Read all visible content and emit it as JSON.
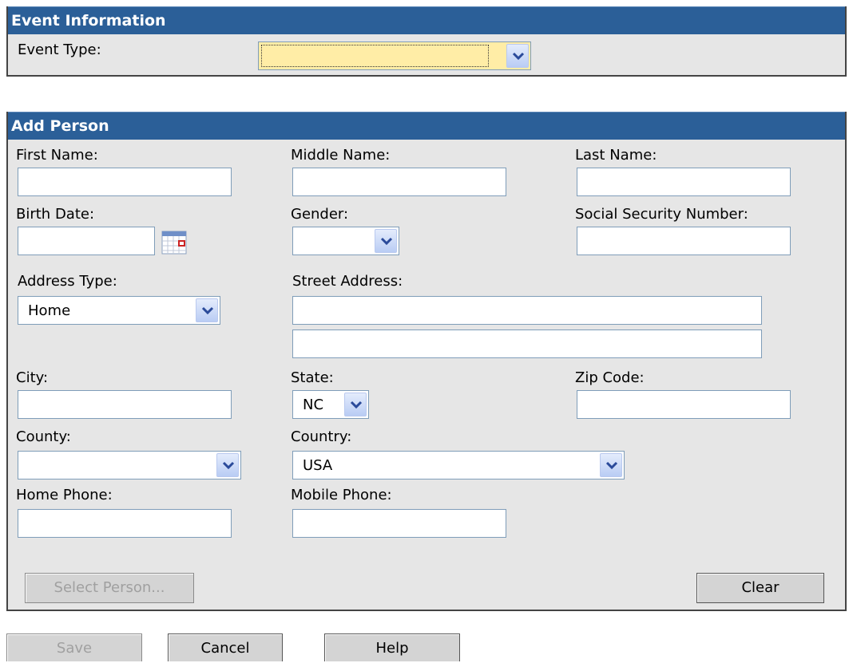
{
  "event": {
    "header": "Event Information",
    "event_type_label": "Event Type:",
    "event_type_value": ""
  },
  "person": {
    "header": "Add Person",
    "first_name_label": "First Name:",
    "middle_name_label": "Middle Name:",
    "last_name_label": "Last Name:",
    "birth_date_label": "Birth Date:",
    "gender_label": "Gender:",
    "gender_value": "",
    "ssn_label": "Social Security Number:",
    "address_type_label": "Address Type:",
    "address_type_value": "Home",
    "street_address_label": "Street Address:",
    "city_label": "City:",
    "state_label": "State:",
    "state_value": "NC",
    "zip_label": "Zip Code:",
    "county_label": "County:",
    "county_value": "",
    "country_label": "Country:",
    "country_value": "USA",
    "home_phone_label": "Home Phone:",
    "mobile_phone_label": "Mobile Phone:",
    "select_person_label": "Select Person...",
    "clear_label": "Clear"
  },
  "footer": {
    "save_label": "Save",
    "cancel_label": "Cancel",
    "help_label": "Help"
  },
  "icons": {
    "dropdown": "chevron-down-icon",
    "calendar": "calendar-icon"
  },
  "colors": {
    "header_bg": "#2b5f98",
    "panel_bg": "#e6e6e6",
    "focused_field_bg": "#ffeda6"
  }
}
